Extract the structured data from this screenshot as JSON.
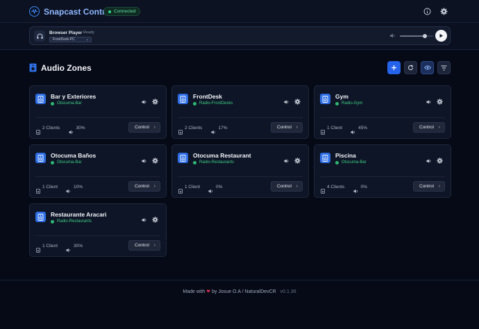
{
  "header": {
    "app_title": "Snapcast Control",
    "connection_status": "Connected"
  },
  "player": {
    "title": "Browser Player",
    "status": "Ready",
    "selected_client": "FrontDesk-PC",
    "volume": 0.75
  },
  "section": {
    "title": "Audio Zones"
  },
  "zones": [
    {
      "name": "Bar y Exteriores",
      "stream": "Otocuma-Bar",
      "clients": "2 Clients",
      "volume": "30%",
      "control_label": "Control"
    },
    {
      "name": "FrontDesk",
      "stream": "Radio-FrontDesks",
      "clients": "2 Clients",
      "volume": "17%",
      "control_label": "Control"
    },
    {
      "name": "Gym",
      "stream": "Radio-Gym",
      "clients": "1 Client",
      "volume": "45%",
      "control_label": "Control"
    },
    {
      "name": "Otocuma Baños",
      "stream": "Otocuma-Bar",
      "clients": "1 Client",
      "volume": "10%",
      "control_label": "Control"
    },
    {
      "name": "Otocuma Restaurant",
      "stream": "Radio-Restaurants",
      "clients": "1 Client",
      "volume": "0%",
      "control_label": "Control"
    },
    {
      "name": "Piscina",
      "stream": "Otocuma-Bar",
      "clients": "4 Clients",
      "volume": "0%",
      "control_label": "Control"
    },
    {
      "name": "Restaurante Aracari",
      "stream": "Radio-Restaurants",
      "clients": "1 Client",
      "volume": "30%",
      "control_label": "Control"
    }
  ],
  "footer": {
    "made_with": "Made with",
    "heart": "❤",
    "by": "by Josue O.A / NaturalDevCR",
    "version": "v0.1.36"
  },
  "colors": {
    "accent": "#2563eb",
    "status_green": "#35d48a",
    "background": "#060a17",
    "card": "#0e1526"
  }
}
